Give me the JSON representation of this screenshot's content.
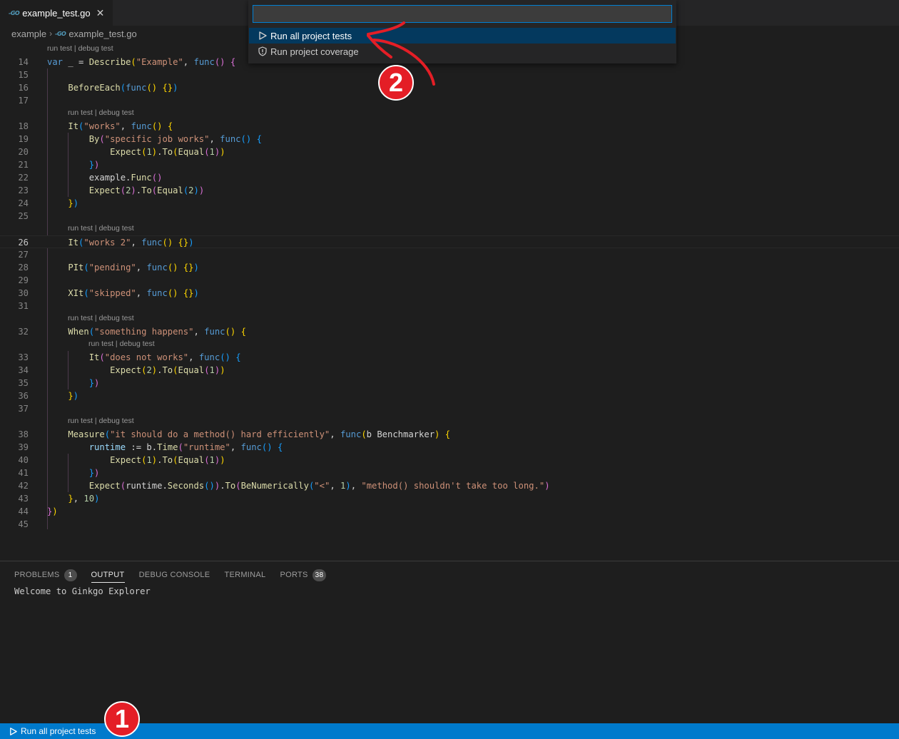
{
  "tab": {
    "icon": "go-file-icon",
    "icon_text": "-GO",
    "label": "example_test.go",
    "close": "✕"
  },
  "breadcrumb": {
    "folder": "example",
    "separator": "›",
    "file": "example_test.go"
  },
  "lens": "run test | debug test",
  "editor": {
    "current_line": "26",
    "lines": [
      {
        "n": "14",
        "tokens": [
          [
            "kw",
            "var"
          ],
          [
            "txt",
            " _ = "
          ],
          [
            "fn",
            "Describe"
          ],
          [
            "b1",
            "("
          ],
          [
            "str",
            "\"Example\""
          ],
          [
            "txt",
            ", "
          ],
          [
            "kw",
            "func"
          ],
          [
            "b2",
            "()"
          ],
          [
            "txt",
            " "
          ],
          [
            "b2",
            "{"
          ]
        ]
      },
      {
        "n": "15",
        "tokens": []
      },
      {
        "n": "16",
        "tokens": [
          [
            "txt",
            "    "
          ],
          [
            "fn",
            "BeforeEach"
          ],
          [
            "b3",
            "("
          ],
          [
            "kw",
            "func"
          ],
          [
            "b1",
            "()"
          ],
          [
            "txt",
            " "
          ],
          [
            "b1",
            "{}"
          ],
          [
            "b3",
            ")"
          ]
        ]
      },
      {
        "n": "17",
        "tokens": []
      },
      {
        "n": "18",
        "tokens": [
          [
            "txt",
            "    "
          ],
          [
            "fn",
            "It"
          ],
          [
            "b3",
            "("
          ],
          [
            "str",
            "\"works\""
          ],
          [
            "txt",
            ", "
          ],
          [
            "kw",
            "func"
          ],
          [
            "b1",
            "()"
          ],
          [
            "txt",
            " "
          ],
          [
            "b1",
            "{"
          ]
        ]
      },
      {
        "n": "19",
        "tokens": [
          [
            "txt",
            "        "
          ],
          [
            "fn",
            "By"
          ],
          [
            "b2",
            "("
          ],
          [
            "str",
            "\"specific job works\""
          ],
          [
            "txt",
            ", "
          ],
          [
            "kw",
            "func"
          ],
          [
            "b3",
            "()"
          ],
          [
            "txt",
            " "
          ],
          [
            "b3",
            "{"
          ]
        ]
      },
      {
        "n": "20",
        "tokens": [
          [
            "txt",
            "            "
          ],
          [
            "fn",
            "Expect"
          ],
          [
            "b1",
            "("
          ],
          [
            "num",
            "1"
          ],
          [
            "b1",
            ")"
          ],
          [
            "txt",
            "."
          ],
          [
            "fn",
            "To"
          ],
          [
            "b1",
            "("
          ],
          [
            "fn",
            "Equal"
          ],
          [
            "b2",
            "("
          ],
          [
            "num",
            "1"
          ],
          [
            "b2",
            ")"
          ],
          [
            "b1",
            ")"
          ]
        ]
      },
      {
        "n": "21",
        "tokens": [
          [
            "txt",
            "        "
          ],
          [
            "b3",
            "}"
          ],
          [
            "b2",
            ")"
          ]
        ]
      },
      {
        "n": "22",
        "tokens": [
          [
            "txt",
            "        example."
          ],
          [
            "fn",
            "Func"
          ],
          [
            "b2",
            "()"
          ]
        ]
      },
      {
        "n": "23",
        "tokens": [
          [
            "txt",
            "        "
          ],
          [
            "fn",
            "Expect"
          ],
          [
            "b2",
            "("
          ],
          [
            "num",
            "2"
          ],
          [
            "b2",
            ")"
          ],
          [
            "txt",
            "."
          ],
          [
            "fn",
            "To"
          ],
          [
            "b2",
            "("
          ],
          [
            "fn",
            "Equal"
          ],
          [
            "b3",
            "("
          ],
          [
            "num",
            "2"
          ],
          [
            "b3",
            ")"
          ],
          [
            "b2",
            ")"
          ]
        ]
      },
      {
        "n": "24",
        "tokens": [
          [
            "txt",
            "    "
          ],
          [
            "b1",
            "}"
          ],
          [
            "b3",
            ")"
          ]
        ]
      },
      {
        "n": "25",
        "tokens": []
      },
      {
        "n": "26",
        "tokens": [
          [
            "txt",
            "    "
          ],
          [
            "fn",
            "It"
          ],
          [
            "b3",
            "("
          ],
          [
            "str",
            "\"works 2\""
          ],
          [
            "txt",
            ", "
          ],
          [
            "kw",
            "func"
          ],
          [
            "b1",
            "()"
          ],
          [
            "txt",
            " "
          ],
          [
            "b1",
            "{}"
          ],
          [
            "b3",
            ")"
          ]
        ]
      },
      {
        "n": "27",
        "tokens": []
      },
      {
        "n": "28",
        "tokens": [
          [
            "txt",
            "    "
          ],
          [
            "fn",
            "PIt"
          ],
          [
            "b3",
            "("
          ],
          [
            "str",
            "\"pending\""
          ],
          [
            "txt",
            ", "
          ],
          [
            "kw",
            "func"
          ],
          [
            "b1",
            "()"
          ],
          [
            "txt",
            " "
          ],
          [
            "b1",
            "{}"
          ],
          [
            "b3",
            ")"
          ]
        ]
      },
      {
        "n": "29",
        "tokens": []
      },
      {
        "n": "30",
        "tokens": [
          [
            "txt",
            "    "
          ],
          [
            "fn",
            "XIt"
          ],
          [
            "b3",
            "("
          ],
          [
            "str",
            "\"skipped\""
          ],
          [
            "txt",
            ", "
          ],
          [
            "kw",
            "func"
          ],
          [
            "b1",
            "()"
          ],
          [
            "txt",
            " "
          ],
          [
            "b1",
            "{}"
          ],
          [
            "b3",
            ")"
          ]
        ]
      },
      {
        "n": "31",
        "tokens": []
      },
      {
        "n": "32",
        "tokens": [
          [
            "txt",
            "    "
          ],
          [
            "fn",
            "When"
          ],
          [
            "b3",
            "("
          ],
          [
            "str",
            "\"something happens\""
          ],
          [
            "txt",
            ", "
          ],
          [
            "kw",
            "func"
          ],
          [
            "b1",
            "()"
          ],
          [
            "txt",
            " "
          ],
          [
            "b1",
            "{"
          ]
        ]
      },
      {
        "n": "33",
        "tokens": [
          [
            "txt",
            "        "
          ],
          [
            "fn",
            "It"
          ],
          [
            "b2",
            "("
          ],
          [
            "str",
            "\"does not works\""
          ],
          [
            "txt",
            ", "
          ],
          [
            "kw",
            "func"
          ],
          [
            "b3",
            "()"
          ],
          [
            "txt",
            " "
          ],
          [
            "b3",
            "{"
          ]
        ]
      },
      {
        "n": "34",
        "tokens": [
          [
            "txt",
            "            "
          ],
          [
            "fn",
            "Expect"
          ],
          [
            "b1",
            "("
          ],
          [
            "num",
            "2"
          ],
          [
            "b1",
            ")"
          ],
          [
            "txt",
            "."
          ],
          [
            "fn",
            "To"
          ],
          [
            "b1",
            "("
          ],
          [
            "fn",
            "Equal"
          ],
          [
            "b2",
            "("
          ],
          [
            "num",
            "1"
          ],
          [
            "b2",
            ")"
          ],
          [
            "b1",
            ")"
          ]
        ]
      },
      {
        "n": "35",
        "tokens": [
          [
            "txt",
            "        "
          ],
          [
            "b3",
            "}"
          ],
          [
            "b2",
            ")"
          ]
        ]
      },
      {
        "n": "36",
        "tokens": [
          [
            "txt",
            "    "
          ],
          [
            "b1",
            "}"
          ],
          [
            "b3",
            ")"
          ]
        ]
      },
      {
        "n": "37",
        "tokens": []
      },
      {
        "n": "38",
        "tokens": [
          [
            "txt",
            "    "
          ],
          [
            "fn",
            "Measure"
          ],
          [
            "b3",
            "("
          ],
          [
            "str",
            "\"it should do a method() hard efficiently\""
          ],
          [
            "txt",
            ", "
          ],
          [
            "kw",
            "func"
          ],
          [
            "b1",
            "("
          ],
          [
            "txt",
            "b Benchmarker"
          ],
          [
            "b1",
            ")"
          ],
          [
            "txt",
            " "
          ],
          [
            "b1",
            "{"
          ]
        ]
      },
      {
        "n": "39",
        "tokens": [
          [
            "txt",
            "        "
          ],
          [
            "var",
            "runtime"
          ],
          [
            "txt",
            " := b."
          ],
          [
            "fn",
            "Time"
          ],
          [
            "b2",
            "("
          ],
          [
            "str",
            "\"runtime\""
          ],
          [
            "txt",
            ", "
          ],
          [
            "kw",
            "func"
          ],
          [
            "b3",
            "()"
          ],
          [
            "txt",
            " "
          ],
          [
            "b3",
            "{"
          ]
        ]
      },
      {
        "n": "40",
        "tokens": [
          [
            "txt",
            "            "
          ],
          [
            "fn",
            "Expect"
          ],
          [
            "b1",
            "("
          ],
          [
            "num",
            "1"
          ],
          [
            "b1",
            ")"
          ],
          [
            "txt",
            "."
          ],
          [
            "fn",
            "To"
          ],
          [
            "b1",
            "("
          ],
          [
            "fn",
            "Equal"
          ],
          [
            "b2",
            "("
          ],
          [
            "num",
            "1"
          ],
          [
            "b2",
            ")"
          ],
          [
            "b1",
            ")"
          ]
        ]
      },
      {
        "n": "41",
        "tokens": [
          [
            "txt",
            "        "
          ],
          [
            "b3",
            "}"
          ],
          [
            "b2",
            ")"
          ]
        ]
      },
      {
        "n": "42",
        "tokens": [
          [
            "txt",
            "        "
          ],
          [
            "fn",
            "Expect"
          ],
          [
            "b2",
            "("
          ],
          [
            "txt",
            "runtime."
          ],
          [
            "fn",
            "Seconds"
          ],
          [
            "b3",
            "()"
          ],
          [
            "b2",
            ")"
          ],
          [
            "txt",
            "."
          ],
          [
            "fn",
            "To"
          ],
          [
            "b2",
            "("
          ],
          [
            "fn",
            "BeNumerically"
          ],
          [
            "b3",
            "("
          ],
          [
            "str",
            "\"<\""
          ],
          [
            "txt",
            ", "
          ],
          [
            "num",
            "1"
          ],
          [
            "b3",
            ")"
          ],
          [
            "txt",
            ", "
          ],
          [
            "str",
            "\"method() shouldn't take too long.\""
          ],
          [
            "b2",
            ")"
          ]
        ]
      },
      {
        "n": "43",
        "tokens": [
          [
            "txt",
            "    "
          ],
          [
            "b1",
            "}"
          ],
          [
            "txt",
            ", "
          ],
          [
            "num",
            "10"
          ],
          [
            "b3",
            ")"
          ]
        ]
      },
      {
        "n": "44",
        "tokens": [
          [
            "b2",
            "}"
          ],
          [
            "b1",
            ")"
          ]
        ]
      },
      {
        "n": "45",
        "tokens": []
      }
    ]
  },
  "panel": {
    "tabs": [
      {
        "label": "PROBLEMS",
        "badge": "1"
      },
      {
        "label": "OUTPUT",
        "badge": ""
      },
      {
        "label": "DEBUG CONSOLE",
        "badge": ""
      },
      {
        "label": "TERMINAL",
        "badge": ""
      },
      {
        "label": "PORTS",
        "badge": "38"
      }
    ],
    "active_tab": "OUTPUT",
    "output": "Welcome to Ginkgo Explorer"
  },
  "quickpick": {
    "input_value": "",
    "items": [
      {
        "icon": "run-icon",
        "label": "Run all project tests",
        "selected": true
      },
      {
        "icon": "shield-icon",
        "label": "Run project coverage",
        "selected": false
      }
    ]
  },
  "statusbar": {
    "icon": "run-icon",
    "label": "Run all project tests"
  },
  "annotations": {
    "one": "1",
    "two": "2",
    "accent": "#e41e26"
  }
}
